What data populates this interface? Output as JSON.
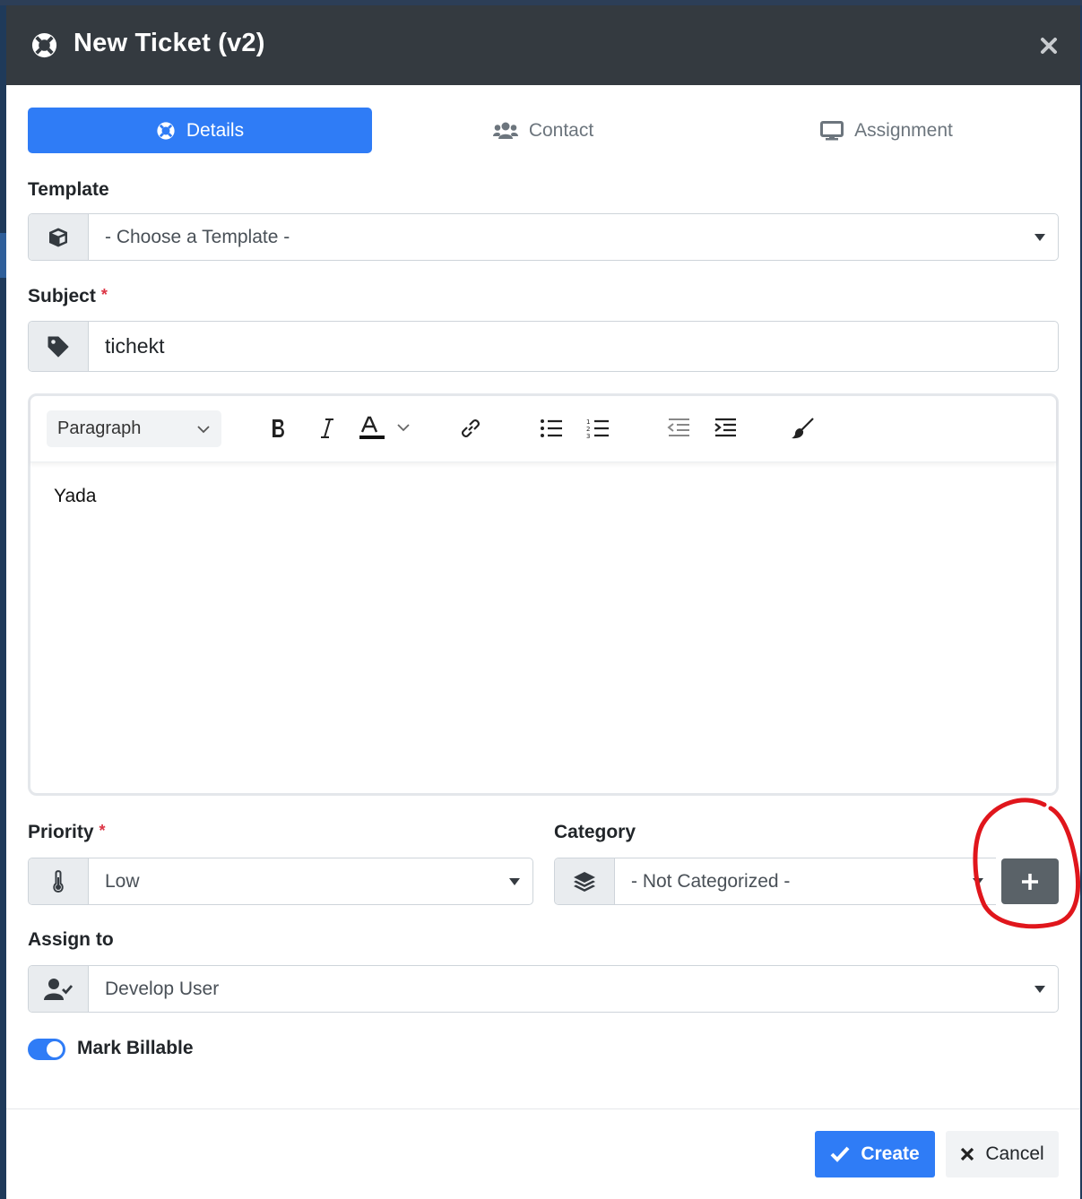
{
  "modal": {
    "title": "New Ticket (v2)"
  },
  "tabs": [
    {
      "label": "Details",
      "icon": "life-ring-icon",
      "active": true
    },
    {
      "label": "Contact",
      "icon": "users-icon",
      "active": false
    },
    {
      "label": "Assignment",
      "icon": "desktop-icon",
      "active": false
    }
  ],
  "template": {
    "label": "Template",
    "value": "- Choose a Template -",
    "icon": "cube-icon"
  },
  "subject": {
    "label": "Subject",
    "required_mark": "*",
    "value": "tichekt",
    "icon": "tag-icon"
  },
  "editor": {
    "format_select": "Paragraph",
    "tools": [
      "bold-icon",
      "italic-icon",
      "font-color-icon",
      "link-icon",
      "bulleted-list-icon",
      "numbered-list-icon",
      "outdent-icon",
      "indent-icon",
      "remove-format-icon"
    ],
    "content": "Yada"
  },
  "priority": {
    "label": "Priority",
    "required_mark": "*",
    "value": "Low",
    "icon": "thermometer-icon"
  },
  "category": {
    "label": "Category",
    "value": "- Not Categorized -",
    "icon": "layers-icon",
    "add_button": "plus-icon"
  },
  "assign_to": {
    "label": "Assign to",
    "value": "Develop User",
    "icon": "user-check-icon"
  },
  "billable": {
    "label": "Mark Billable",
    "checked": true
  },
  "footer": {
    "create_label": "Create",
    "cancel_label": "Cancel"
  },
  "colors": {
    "primary": "#2f7cf6",
    "header_bg": "#343a40",
    "required": "#dc3545",
    "annotation": "#e0161c"
  }
}
